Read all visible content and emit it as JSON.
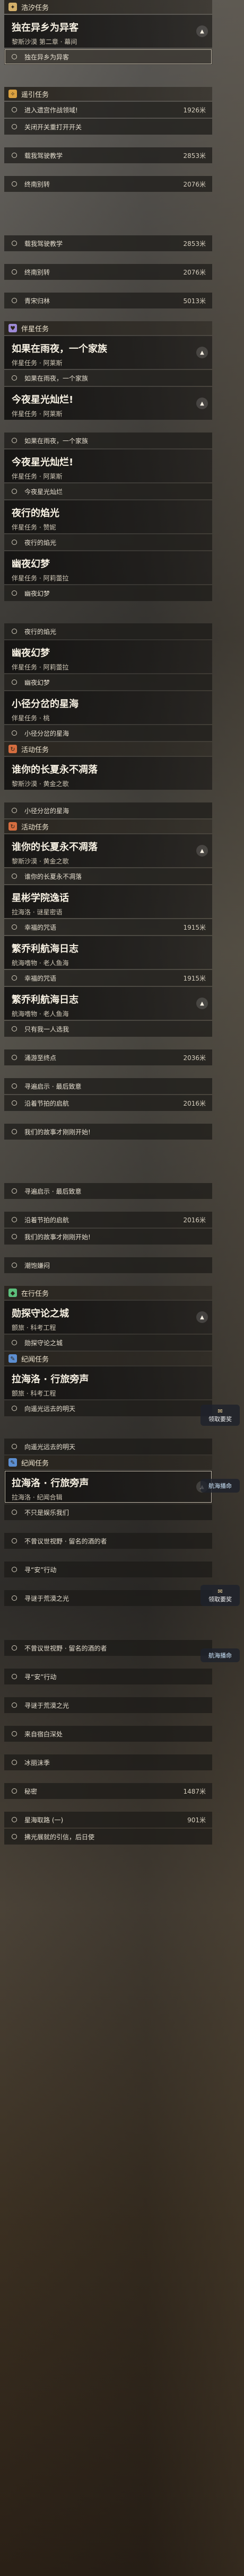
{
  "colors": {
    "haoyue": "#d4b06a",
    "yaoyin": "#d9a040",
    "banxing": "#9d8ad6",
    "huodong": "#d56d3f",
    "zaixing": "#5cbf7c",
    "jiwen": "#5d8fd1"
  },
  "sec1": {
    "cat": "浩汐任务",
    "card_title": "独在异乡为异客",
    "card_sub": "黎斯沙漠 第二章 · 幕间",
    "row": "独在异乡为异客"
  },
  "sec2": {
    "cat": "遥引任务",
    "rows": [
      {
        "text": "进入遗宫作战领域!",
        "dist": "1926米"
      },
      {
        "text": "关闭开关重打开开关",
        "dist": ""
      },
      {
        "text": "载我驾驶教学",
        "dist": "2853米"
      },
      {
        "text": "终南别转",
        "dist": "2076米"
      }
    ],
    "rows2": [
      {
        "text": "载我驾驶教学",
        "dist": "2853米"
      },
      {
        "text": "终南别转",
        "dist": "2076米"
      },
      {
        "text": "青宋归林",
        "dist": "5013米"
      }
    ]
  },
  "sec3": {
    "cat": "伴星任务",
    "c1": {
      "title": "如果在雨夜，一个家族",
      "sub": "伴星任务 · 阿莱斯"
    },
    "r1": "如果在雨夜，一个家族",
    "c2": {
      "title": "今夜星光灿烂!",
      "sub": "伴星任务 · 阿莱斯"
    },
    "r2": "如果在雨夜，一个家族",
    "c3": {
      "title": "今夜星光灿烂!",
      "sub": "伴星任务 · 阿莱斯"
    },
    "r3": "今夜星光灿烂",
    "c4": {
      "title": "夜行的焰光",
      "sub": "伴星任务 · 赞妮"
    },
    "r4": "夜行的焰光",
    "c5": {
      "title": "幽夜幻梦",
      "sub": "伴星任务 · 阿莉蕾拉"
    },
    "r5": "幽夜幻梦",
    "r6": "夜行的焰光",
    "c6": {
      "title": "幽夜幻梦",
      "sub": "伴星任务 · 阿莉蕾拉"
    },
    "r7": "幽夜幻梦",
    "c7": {
      "title": "小径分岔的星海",
      "sub": "伴星任务 · 桃"
    },
    "r8": "小径分岔的星海"
  },
  "sec4": {
    "cat": "活动任务",
    "c1": {
      "title": "谁你的长夏永不凋落",
      "sub": "黎斯沙漠 · 黄金之歌"
    },
    "r1": "小径分岔的星海"
  },
  "sec5": {
    "cat": "活动任务",
    "c1": {
      "title": "谁你的长夏永不凋落",
      "sub": "黎斯沙漠 · 黄金之歌"
    },
    "r1": "谁你的长夏永不凋落",
    "c2": {
      "title": "星彬学院逸话",
      "sub": "拉海洛 · 谜星密语"
    },
    "r2": "幸福的咒语",
    "dist2": "1915米",
    "c3": {
      "title": "繁乔利航海日志",
      "sub": "航海嗜物 · 老人鱼海"
    },
    "r3": "幸福的咒语",
    "dist3": "1915米",
    "c4": {
      "title": "繁乔利航海日志",
      "sub": "航海嗜物 · 老人鱼海"
    },
    "rows": [
      {
        "text": "只有我一人选我",
        "dist": ""
      },
      {
        "text": "涌游至终点",
        "dist": "2036米"
      },
      {
        "text": "寻遍启示 · 最后致意",
        "dist": ""
      },
      {
        "text": "沿着节拍的启航",
        "dist": "2016米"
      },
      {
        "text": "我们的故事才刚刚开始!",
        "dist": ""
      }
    ],
    "rows2": [
      {
        "text": "寻遍启示 · 最后致意",
        "dist": ""
      },
      {
        "text": "沿着节拍的启航",
        "dist": "2016米"
      },
      {
        "text": "我们的故事才刚刚开始!",
        "dist": ""
      },
      {
        "text": "潮饱嫌闷",
        "dist": ""
      }
    ]
  },
  "sec6": {
    "cat": "在行任务",
    "c1": {
      "title": "勋探守论之城",
      "sub": "颤旅 · 科考工程"
    },
    "r1": "勋探守论之城"
  },
  "sec7": {
    "cat": "纪闻任务",
    "c1": {
      "title": "拉海洛 · 行旅旁声",
      "sub": "颤旅 · 科考工程"
    },
    "r1": "向遥光远去的明天",
    "r2": "向遥光远去的明天"
  },
  "sec8": {
    "cat": "纪闻任务",
    "c1": {
      "title": "拉海洛 · 行旅旁声",
      "sub": "拉海洛 · 纪闻合辑"
    },
    "rows": [
      {
        "text": "不只是娱乐我们",
        "dist": ""
      },
      {
        "text": "不曾议世视野 · 留名的酒的者",
        "dist": ""
      },
      {
        "text": "寻“安”行动",
        "dist": ""
      },
      {
        "text": "寻谜于荒漠之光",
        "dist": ""
      }
    ],
    "rows2": [
      {
        "text": "不曾议世视野 · 留名的酒的者",
        "dist": ""
      },
      {
        "text": "寻“安”行动",
        "dist": ""
      },
      {
        "text": "寻谜于荒漠之光",
        "dist": ""
      },
      {
        "text": "来自宿白深处",
        "dist": ""
      },
      {
        "text": "冰丽沫季",
        "dist": ""
      },
      {
        "text": "秘密",
        "dist": "1487米"
      },
      {
        "text": "星海取路 (一)",
        "dist": "901米"
      },
      {
        "text": "拂光展就的引信，后日使",
        "dist": ""
      }
    ]
  },
  "floats": {
    "reward": "领取要奖",
    "nav": "航海播命"
  }
}
